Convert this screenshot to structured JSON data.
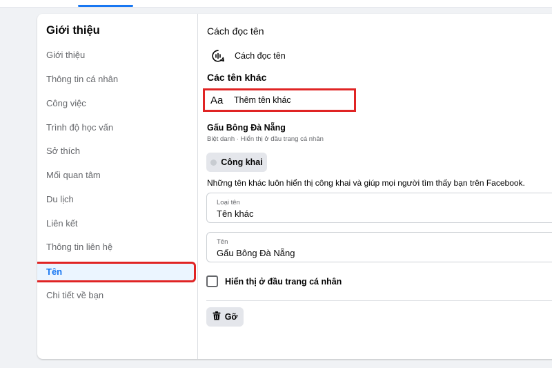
{
  "sidebar": {
    "title": "Giới thiệu",
    "items": [
      {
        "label": "Giới thiệu"
      },
      {
        "label": "Thông tin cá nhân"
      },
      {
        "label": "Công việc"
      },
      {
        "label": "Trình độ học vấn"
      },
      {
        "label": "Sở thích"
      },
      {
        "label": "Mối quan tâm"
      },
      {
        "label": "Du lịch"
      },
      {
        "label": "Liên kết"
      },
      {
        "label": "Thông tin liên hệ"
      },
      {
        "label": "Tên",
        "active": true
      },
      {
        "label": "Chi tiết về bạn"
      }
    ]
  },
  "main": {
    "pronunciation_title": "Cách đọc tên",
    "pronunciation_item": "Cách đọc tên",
    "other_names_title": "Các tên khác",
    "add_other_name": "Thêm tên khác",
    "nickname": "Gấu Bông Đà Nẵng",
    "nickname_sub": "Biệt danh · Hiển thị ở đầu trang cá nhân",
    "privacy_button": "Công khai",
    "info_text": "Những tên khác luôn hiển thị công khai và giúp mọi người tìm thấy bạn trên Facebook.",
    "type_field": {
      "label": "Loại tên",
      "value": "Tên khác"
    },
    "name_field": {
      "label": "Tên",
      "value": "Gấu Bông Đà Nẵng"
    },
    "show_top_label": "Hiển thị ở đầu trang cá nhân",
    "remove_button": "Gỡ"
  },
  "colors": {
    "accent": "#1877f2",
    "highlight_border": "#e02424"
  }
}
